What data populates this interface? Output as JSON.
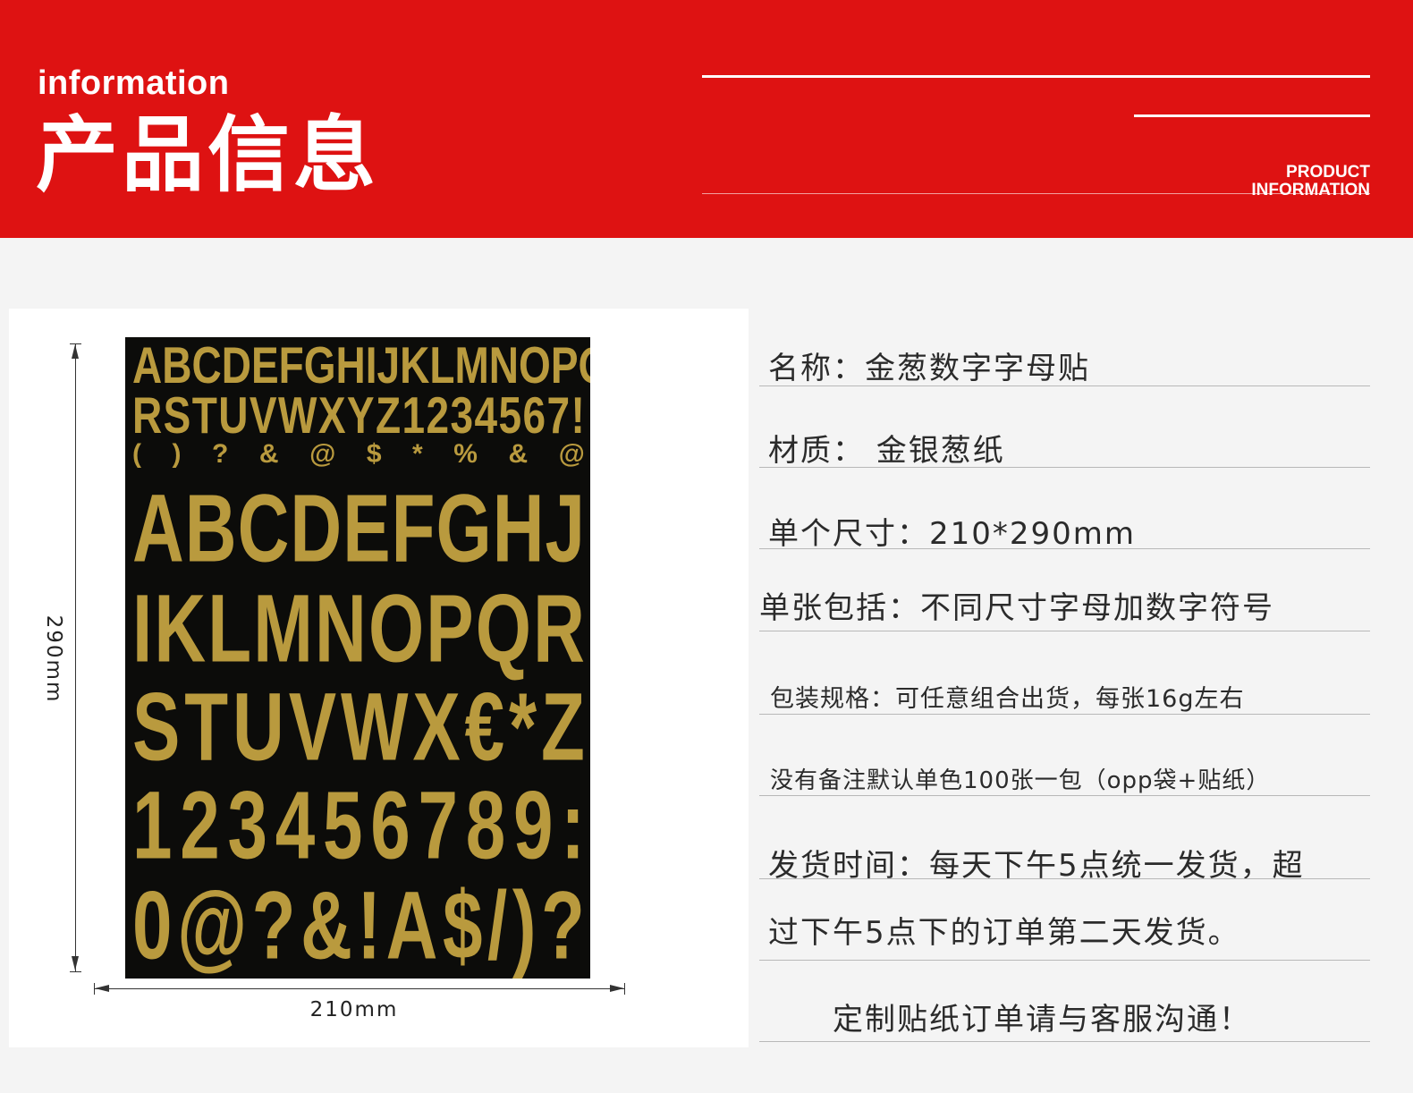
{
  "banner": {
    "en_title": "information",
    "cn_title": "产品信息",
    "tag_line1": "PRODUCT",
    "tag_line2": "INFORMATION",
    "color": "#de1212"
  },
  "product_image": {
    "width_label": "210mm",
    "height_label": "290mm",
    "sheet_background": "#0c0c0a",
    "glyph_color": "#b99a3e",
    "rows": [
      "ABCDEFGHIJKLMNOPQ",
      "RSTUVWXYZ1234567!",
      "()?&@$*%&@",
      "ABCDEFGHJ",
      "IKLMNOPQR",
      "STUVWX€*Z",
      "123456789:",
      "0@?&!A$/)?"
    ]
  },
  "info": {
    "name": "名称：金葱数字字母贴",
    "material": "材质： 金银葱纸",
    "size": "单个尺寸：210*290mm",
    "contents": "单张包括：不同尺寸字母加数字符号",
    "packaging": "包装规格：可任意组合出货，每张16g左右",
    "default_pack": "没有备注默认单色100张一包（opp袋+贴纸）",
    "shipping_line1": "发货时间：每天下午5点统一发货，超",
    "shipping_line2": "过下午5点下的订单第二天发货。",
    "custom_note": "定制贴纸订单请与客服沟通！"
  }
}
